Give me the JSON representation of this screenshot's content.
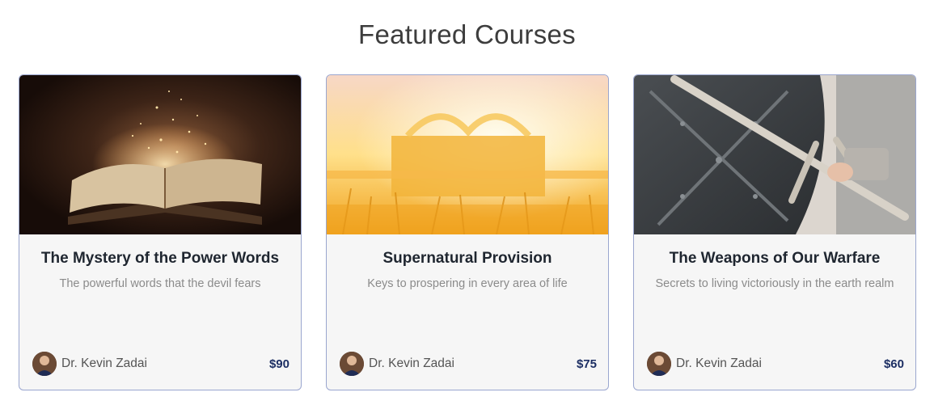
{
  "section": {
    "title": "Featured Courses"
  },
  "courses": [
    {
      "title": "The Mystery of the Power Words",
      "description": "The powerful words that the devil fears",
      "author": "Dr. Kevin Zadai",
      "price": "$90",
      "image": "open-bible-glowing-image"
    },
    {
      "title": "Supernatural Provision",
      "description": "Keys to prospering in every area of life",
      "author": "Dr. Kevin Zadai",
      "price": "$75",
      "image": "ark-in-wheat-field-image"
    },
    {
      "title": "The Weapons of Our Warfare",
      "description": "Secrets to living victoriously in the earth realm",
      "author": "Dr. Kevin Zadai",
      "price": "$60",
      "image": "knight-sword-shield-image"
    }
  ],
  "colors": {
    "card_border": "#9aa6cf",
    "price": "#1c2e63",
    "card_bg": "#f6f6f6"
  }
}
